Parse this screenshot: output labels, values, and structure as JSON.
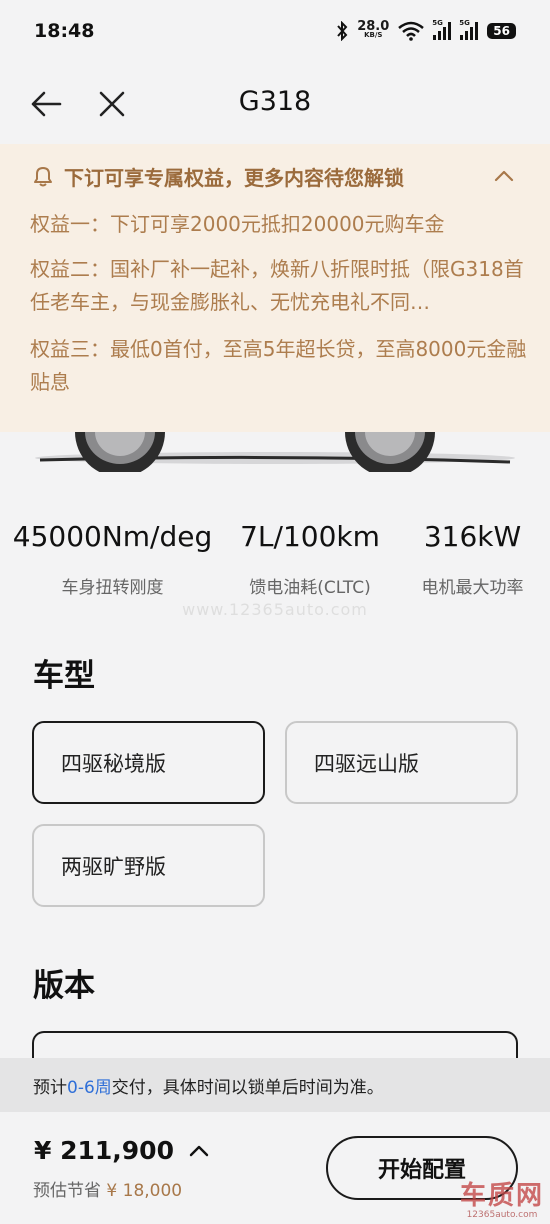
{
  "status": {
    "time": "18:48",
    "speed_value": "28.0",
    "speed_unit": "KB/S",
    "sig1_tag": "5G",
    "sig2_tag": "5G",
    "battery": "56"
  },
  "header": {
    "title": "G318"
  },
  "benefits": {
    "title": "下订可享专属权益，更多内容待您解锁",
    "items": [
      "权益一：下订可享2000元抵扣20000元购车金",
      "权益二：国补厂补一起补，焕新八折限时抵（限G318首任老车主，与现金膨胀礼、无忧充电礼不同…",
      "权益三：最低0首付，至高5年超长贷，至高8000元金融贴息"
    ]
  },
  "specs": [
    {
      "value": "45000Nm/deg",
      "label": "车身扭转刚度"
    },
    {
      "value": "7L/100km",
      "label": "馈电油耗(CLTC)"
    },
    {
      "value": "316kW",
      "label": "电机最大功率"
    }
  ],
  "watermark": "www.12365auto.com",
  "model_section": {
    "title": "车型",
    "options": [
      "四驱秘境版",
      "四驱远山版",
      "两驱旷野版"
    ],
    "selected": "四驱秘境版"
  },
  "version_section": {
    "title": "版本"
  },
  "notice": {
    "prefix": "预计",
    "highlight": "0-6周",
    "suffix": "交付，具体时间以锁单后时间为准。"
  },
  "bottom": {
    "price": "¥ 211,900",
    "saving_label": "预估节省",
    "saving_amount": "¥ 18,000",
    "cta": "开始配置"
  },
  "logo": {
    "big": "车质网",
    "small": "12365auto.com"
  },
  "colors": {
    "accent_gold": "#a8784a",
    "benefits_bg": "#f8efe4",
    "link_blue": "#2f6fd8"
  }
}
